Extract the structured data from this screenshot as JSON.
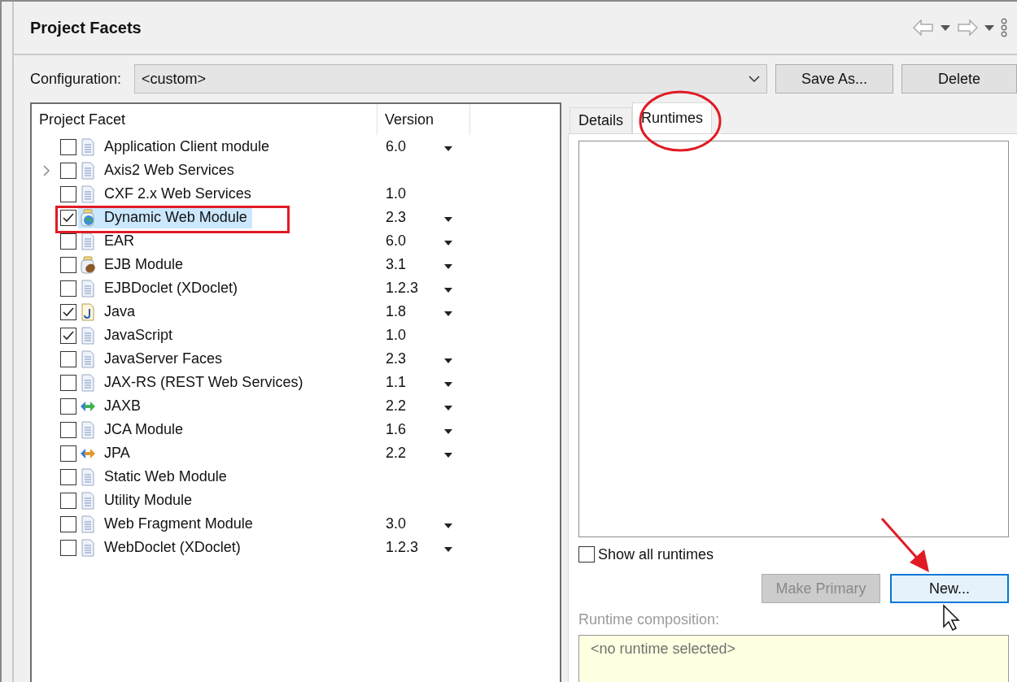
{
  "title": "Project Facets",
  "configuration": {
    "label": "Configuration:",
    "value": "<custom>"
  },
  "config_buttons": [
    {
      "label": "Save As..."
    },
    {
      "label": "Delete"
    }
  ],
  "facets_table": {
    "columns": [
      "Project Facet",
      "Version"
    ],
    "rows": [
      {
        "name": "Application Client module",
        "version": "6.0",
        "kind": "doc",
        "checked": false,
        "selected": false,
        "expandable": false,
        "has_menu": true
      },
      {
        "name": "Axis2 Web Services",
        "kind": "doc",
        "checked": false,
        "selected": false,
        "expandable": true,
        "has_menu": false
      },
      {
        "name": "CXF 2.x Web Services",
        "version": "1.0",
        "kind": "doc",
        "checked": false,
        "selected": false,
        "expandable": false,
        "has_menu": false
      },
      {
        "name": "Dynamic Web Module",
        "version": "2.3",
        "kind": "web",
        "checked": true,
        "selected": true,
        "expandable": false,
        "has_menu": true
      },
      {
        "name": "EAR",
        "version": "6.0",
        "kind": "doc",
        "checked": false,
        "selected": false,
        "expandable": false,
        "has_menu": true
      },
      {
        "name": "EJB Module",
        "version": "3.1",
        "kind": "ejb",
        "checked": false,
        "selected": false,
        "expandable": false,
        "has_menu": true
      },
      {
        "name": "EJBDoclet (XDoclet)",
        "version": "1.2.3",
        "kind": "doc",
        "checked": false,
        "selected": false,
        "expandable": false,
        "has_menu": true
      },
      {
        "name": "Java",
        "version": "1.8",
        "kind": "java",
        "checked": true,
        "selected": false,
        "expandable": false,
        "has_menu": true
      },
      {
        "name": "JavaScript",
        "version": "1.0",
        "kind": "doc",
        "checked": true,
        "selected": false,
        "expandable": false,
        "has_menu": false
      },
      {
        "name": "JavaServer Faces",
        "version": "2.3",
        "kind": "doc",
        "checked": false,
        "selected": false,
        "expandable": false,
        "has_menu": true
      },
      {
        "name": "JAX-RS (REST Web Services)",
        "version": "1.1",
        "kind": "doc",
        "checked": false,
        "selected": false,
        "expandable": false,
        "has_menu": true
      },
      {
        "name": "JAXB",
        "version": "2.2",
        "kind": "arrows-green",
        "checked": false,
        "selected": false,
        "expandable": false,
        "has_menu": true
      },
      {
        "name": "JCA Module",
        "version": "1.6",
        "kind": "doc",
        "checked": false,
        "selected": false,
        "expandable": false,
        "has_menu": true
      },
      {
        "name": "JPA",
        "version": "2.2",
        "kind": "arrows-orange",
        "checked": false,
        "selected": false,
        "expandable": false,
        "has_menu": true
      },
      {
        "name": "Static Web Module",
        "kind": "doc",
        "checked": false,
        "selected": false,
        "expandable": false,
        "has_menu": false
      },
      {
        "name": "Utility Module",
        "kind": "doc",
        "checked": false,
        "selected": false,
        "expandable": false,
        "has_menu": false
      },
      {
        "name": "Web Fragment Module",
        "version": "3.0",
        "kind": "doc",
        "checked": false,
        "selected": false,
        "expandable": false,
        "has_menu": true
      },
      {
        "name": "WebDoclet (XDoclet)",
        "version": "1.2.3",
        "kind": "doc",
        "checked": false,
        "selected": false,
        "expandable": false,
        "has_menu": true
      }
    ]
  },
  "tabs": [
    {
      "label": "Details",
      "selected": false
    },
    {
      "label": "Runtimes",
      "selected": true
    }
  ],
  "show_all_runtimes": {
    "label": "Show all runtimes",
    "checked": false
  },
  "runtime_buttons": [
    {
      "label": "Make Primary",
      "disabled": true,
      "focused": false
    },
    {
      "label": "New...",
      "disabled": false,
      "focused": true
    }
  ],
  "runtime_composition": {
    "label": "Runtime composition:",
    "value": "<no runtime selected>",
    "disabled": true
  }
}
